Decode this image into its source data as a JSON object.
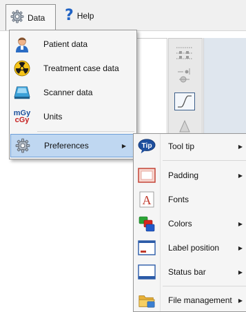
{
  "menubar": {
    "data_label": "Data",
    "help_label": "Help",
    "data_icon": "gear-icon",
    "help_icon": "question-mark-icon",
    "help_glyph": "?"
  },
  "main_menu": {
    "items": [
      {
        "label": "Patient data",
        "icon": "patient-icon"
      },
      {
        "label": "Treatment case data",
        "icon": "radiation-icon"
      },
      {
        "label": "Scanner data",
        "icon": "scanner-icon"
      },
      {
        "label": "Units",
        "icon": "units-icon",
        "icon_text_top": "mGy",
        "icon_text_bottom": "cGy"
      },
      {
        "label": "Preferences",
        "icon": "gear-icon",
        "highlighted": true,
        "has_submenu": true
      }
    ]
  },
  "submenu": {
    "items": [
      {
        "label": "Tool tip",
        "icon": "tip-icon",
        "icon_text": "Tip",
        "has_submenu": true
      },
      {
        "label": "Padding",
        "icon": "padding-icon",
        "has_submenu": true
      },
      {
        "label": "Fonts",
        "icon": "font-icon",
        "icon_text": "A",
        "has_submenu": false
      },
      {
        "label": "Colors",
        "icon": "colors-icon",
        "has_submenu": true
      },
      {
        "label": "Label position",
        "icon": "label-position-icon",
        "has_submenu": true
      },
      {
        "label": "Status bar",
        "icon": "status-bar-icon",
        "has_submenu": true
      },
      {
        "label": "File management",
        "icon": "folder-icon",
        "has_submenu": true
      }
    ]
  },
  "colors": {
    "highlight_bg": "#bfd7f1",
    "highlight_border": "#6e9fd8",
    "menu_bg": "#f5f5f5",
    "help_accent": "#1f62c4"
  }
}
